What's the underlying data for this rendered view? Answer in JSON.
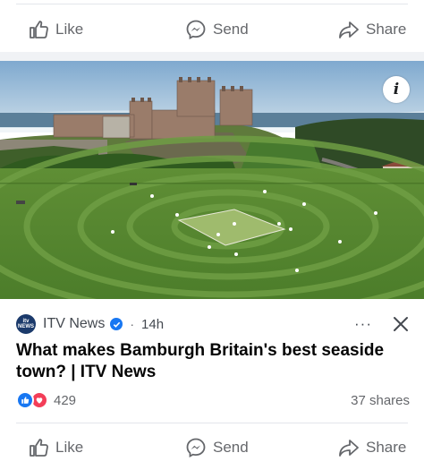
{
  "actions_top": {
    "like": "Like",
    "send": "Send",
    "share": "Share"
  },
  "post": {
    "source_name": "ITV News",
    "source_logo_text": "itv NEWS",
    "time": "14h",
    "separator": "·",
    "more_label": "···",
    "headline": "What makes Bamburgh Britain's best seaside town? | ITV News",
    "info_label": "i"
  },
  "engagement": {
    "reaction_count": "429",
    "shares": "37 shares"
  },
  "actions_bottom": {
    "like": "Like",
    "send": "Send",
    "share": "Share"
  },
  "colors": {
    "facebook_blue": "#1877f2",
    "love_red": "#f33e58",
    "secondary_text": "#65676b"
  }
}
